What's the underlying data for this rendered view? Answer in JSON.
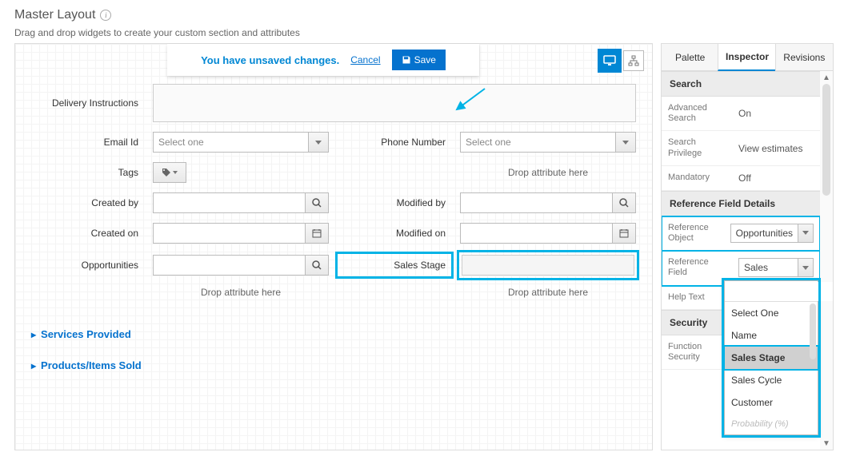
{
  "header": {
    "title": "Master Layout",
    "subtitle": "Drag and drop widgets to create your custom section and attributes"
  },
  "unsaved": {
    "message": "You have unsaved changes.",
    "cancel": "Cancel",
    "save": "Save"
  },
  "canvas": {
    "fields": {
      "delivery_instructions": "Delivery Instructions",
      "email_id": "Email Id",
      "phone_number": "Phone Number",
      "tags": "Tags",
      "created_by": "Created by",
      "modified_by": "Modified by",
      "created_on": "Created on",
      "modified_on": "Modified on",
      "opportunities": "Opportunities",
      "sales_stage": "Sales Stage"
    },
    "select_placeholder": "Select one",
    "drop_hint": "Drop attribute here",
    "sections": {
      "services": "Services Provided",
      "products": "Products/Items Sold"
    }
  },
  "sidebar": {
    "tabs": {
      "palette": "Palette",
      "inspector": "Inspector",
      "revisions": "Revisions"
    },
    "search_section": {
      "title": "Search",
      "rows": [
        {
          "k": "Advanced Search",
          "v": "On"
        },
        {
          "k": "Search Privilege",
          "v": "View estimates"
        },
        {
          "k": "Mandatory",
          "v": "Off"
        }
      ]
    },
    "ref_section": {
      "title": "Reference Field Details",
      "object_label": "Reference Object",
      "object_value": "Opportunities",
      "field_label": "Reference Field",
      "field_value": "Sales Stage",
      "help_label": "Help Text"
    },
    "security_section": {
      "title": "Security",
      "func_label": "Function Security"
    },
    "dropdown": {
      "options": [
        "Select One",
        "Name",
        "Sales Stage",
        "Sales Cycle",
        "Customer"
      ],
      "last_faded": "Probability (%)"
    }
  }
}
